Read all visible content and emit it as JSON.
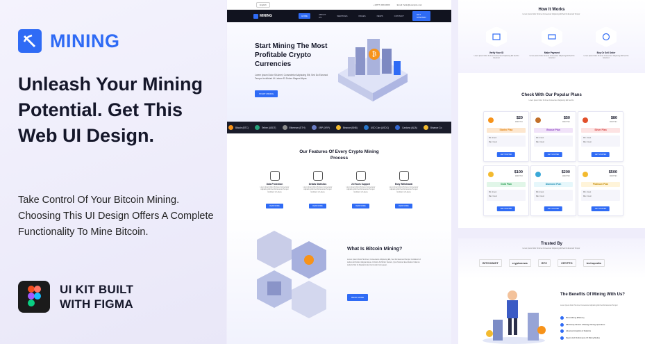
{
  "left": {
    "brand": "MINING",
    "headline": "Unleash Your Mining Potential. Get This Web UI Design.",
    "description": "Take Control Of Your Bitcoin Mining. Choosing This UI Design Offers A Complete Functionality To Mine Bitcoin.",
    "figma_line1": "UI KIT BUILT",
    "figma_line2": "WITH FIGMA"
  },
  "mock": {
    "lang": "English",
    "phone": "+1(877) 000-0000",
    "email": "Email: hello@example.com",
    "logo": "MINING",
    "nav": [
      "HOME",
      "ABOUT US",
      "SERVICES",
      "PAGES",
      "NEWS",
      "CONTACT"
    ],
    "nav_cta": "GET STARTED",
    "hero_title": "Start Mining The Most Profitable Crypto Currencies",
    "hero_text": "Lorem Ipsum Dolor Sit Amet, Consectetur Adipiscing Elit, Sed Do Eiusmod Tempor Incididunt Ut Labore Et Dolore Magna Aliqua.",
    "hero_btn": "START MINING",
    "ticker": [
      {
        "label": "Bitcoin (BTC)",
        "color": "#f7931a"
      },
      {
        "label": "Tether (USDT)",
        "color": "#26a17b"
      },
      {
        "label": "Ethereum (ETH)",
        "color": "#8c8c8c"
      },
      {
        "label": "XRP (XRP)",
        "color": "#6b7dc4"
      },
      {
        "label": "Binance (BNB)",
        "color": "#f3ba2f"
      },
      {
        "label": "USD Coin (USDC)",
        "color": "#2775ca"
      },
      {
        "label": "Cardano (ADA)",
        "color": "#3468d1"
      },
      {
        "label": "Binance Co",
        "color": "#f3ba2f"
      }
    ],
    "features_title": "Our Features Of Every Crypto Mining Process",
    "features": [
      {
        "name": "Data Protection",
        "btn": "READ MORE"
      },
      {
        "name": "Details Statistics",
        "btn": "READ MORE"
      },
      {
        "name": "24 Hours Support",
        "btn": "READ MORE"
      },
      {
        "name": "Easy Withdrawal",
        "btn": "READ MORE"
      }
    ],
    "feature_text": "Lorem Ipsum Dolor Sit Amet Consectetur Adipiscing Elit Sed Do Eiusmod Tempor Incididunt Ut Labore",
    "about_title": "What Is Bitcoin Mining?",
    "about_text": "Lorem Ipsum Dolor Sit Amet, Consectetur Adipiscing Elit, Sed Do Eiusmod Tempor Incididunt Ut Labore Et Dolore Magna Aliqua. Ut Enim Ad Minim Veniam, Quis Nostrud Exercitation Ullamco Laboris Nisi Ut Aliquip Ex Ea Commodo Consequat.",
    "about_btn": "READ MORE"
  },
  "right": {
    "hiw_title": "How It Works",
    "hiw_sub": "Lorem Ipsum Dolor Sit Amet Consectetur Adipiscing Elit Sed Do Eiusmod Tempor",
    "steps": [
      {
        "name": "Verify Your ID"
      },
      {
        "name": "Make Payment"
      },
      {
        "name": "Buy Or Sell Order"
      }
    ],
    "step_text": "Lorem Ipsum Dolor Sit Amet Consectetur Adipiscing Elit Sed Do Eiusmod",
    "plans_title": "Check With Our Popular Plans",
    "plans_sub": "Lorem Ipsum Dolor Sit Amet Consectetur Adipiscing Elit Sed Do",
    "plans": [
      {
        "price": "$20",
        "name": "Starter Plan",
        "tone": "#fde7cf",
        "ink": "#e3820d",
        "coin": "#f7931a"
      },
      {
        "price": "$50",
        "name": "Bronze Plan",
        "tone": "#f1e3f9",
        "ink": "#8a3fbf",
        "coin": "#c2702a"
      },
      {
        "price": "$80",
        "name": "Silver Plan",
        "tone": "#fde3e3",
        "ink": "#d33a3a",
        "coin": "#e2502b"
      },
      {
        "price": "$100",
        "name": "Gold Plan",
        "tone": "#e1f6e8",
        "ink": "#1f9a4c",
        "coin": "#f3ba2f"
      },
      {
        "price": "$200",
        "name": "Diamond Plan",
        "tone": "#e6f7fb",
        "ink": "#1d8fb3",
        "coin": "#3aa8d8"
      },
      {
        "price": "$500",
        "name": "Platinum Plan",
        "tone": "#fff4d9",
        "ink": "#c48a00",
        "coin": "#f3ba2f"
      }
    ],
    "per": "MONTHLY",
    "row1_label": "Min. Invest",
    "row2_label": "Max. Invest",
    "plan_btn": "GET STARTED",
    "trusted_title": "Trusted By",
    "trusted_sub": "Lorem Ipsum Dolor Sit Amet Consectetur Adipiscing Elit Sed Do Eiusmod Tempor",
    "logos": [
      "BITCOINIST",
      "cryptonews",
      "BTC",
      "CRYPTO",
      "techopedia"
    ],
    "benefits_title": "The Benefits Of Mining With Us?",
    "benefits_text": "Lorem Ipsum Dolor Sit Amet Consectetur Adipiscing Elit Sed Do Eiusmod Tempor",
    "benefits": [
      "Boost Mining Efficiency",
      "Effortlessly Monitor & Manage Mining Operations",
      "Advanced Analytics & Statistics",
      "Report And Performance Of Mining Modes"
    ]
  }
}
